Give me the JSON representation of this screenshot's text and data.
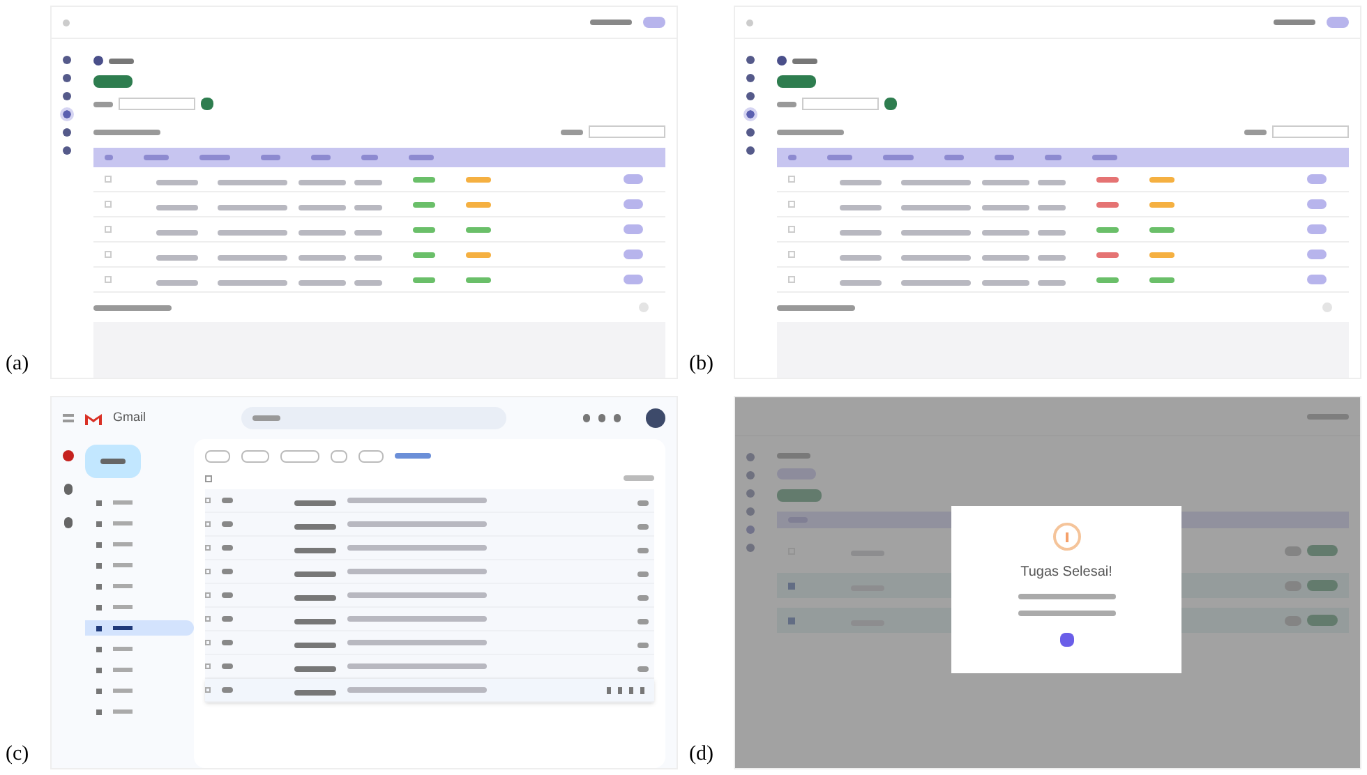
{
  "panels": [
    {
      "label": "(a)",
      "kind": "admin",
      "rows": [
        {
          "checked": false,
          "tags": [
            {
              "color": "#6abf69"
            },
            {
              "color": "#f5b041"
            }
          ]
        },
        {
          "checked": false,
          "tags": [
            {
              "color": "#6abf69"
            },
            {
              "color": "#f5b041"
            }
          ]
        },
        {
          "checked": false,
          "tags": [
            {
              "color": "#6abf69"
            },
            {
              "color": "#6abf69"
            }
          ]
        },
        {
          "checked": false,
          "tags": [
            {
              "color": "#6abf69"
            },
            {
              "color": "#f5b041"
            }
          ]
        },
        {
          "checked": false,
          "tags": [
            {
              "color": "#6abf69"
            },
            {
              "color": "#6abf69"
            }
          ]
        }
      ]
    },
    {
      "label": "(b)",
      "kind": "admin",
      "rows": [
        {
          "checked": false,
          "tags": [
            {
              "color": "#e57373"
            },
            {
              "color": "#f5b041"
            }
          ]
        },
        {
          "checked": false,
          "tags": [
            {
              "color": "#e57373"
            },
            {
              "color": "#f5b041"
            }
          ]
        },
        {
          "checked": false,
          "tags": [
            {
              "color": "#6abf69"
            },
            {
              "color": "#6abf69"
            }
          ]
        },
        {
          "checked": false,
          "tags": [
            {
              "color": "#e57373"
            },
            {
              "color": "#f5b041"
            }
          ]
        },
        {
          "checked": false,
          "tags": [
            {
              "color": "#6abf69"
            },
            {
              "color": "#6abf69"
            }
          ]
        }
      ]
    },
    {
      "label": "(c)",
      "kind": "mail",
      "logo": "Gmail",
      "select_all_checked": false,
      "nav": [
        {
          "selected": false
        },
        {
          "selected": false
        },
        {
          "selected": false
        },
        {
          "selected": false
        },
        {
          "selected": false
        },
        {
          "selected": false
        },
        {
          "selected": true
        },
        {
          "selected": false
        },
        {
          "selected": false
        },
        {
          "selected": false
        },
        {
          "selected": false
        }
      ],
      "mails": [
        {
          "hovered": false
        },
        {
          "hovered": false
        },
        {
          "hovered": false
        },
        {
          "hovered": false
        },
        {
          "hovered": false
        },
        {
          "hovered": false
        },
        {
          "hovered": false
        },
        {
          "hovered": false
        },
        {
          "hovered": true
        }
      ]
    },
    {
      "label": "(d)",
      "kind": "modal",
      "title": "Tugas Selesai!",
      "rows": [
        {
          "checked": false
        },
        {
          "checked": true
        },
        {
          "checked": true
        }
      ]
    }
  ]
}
